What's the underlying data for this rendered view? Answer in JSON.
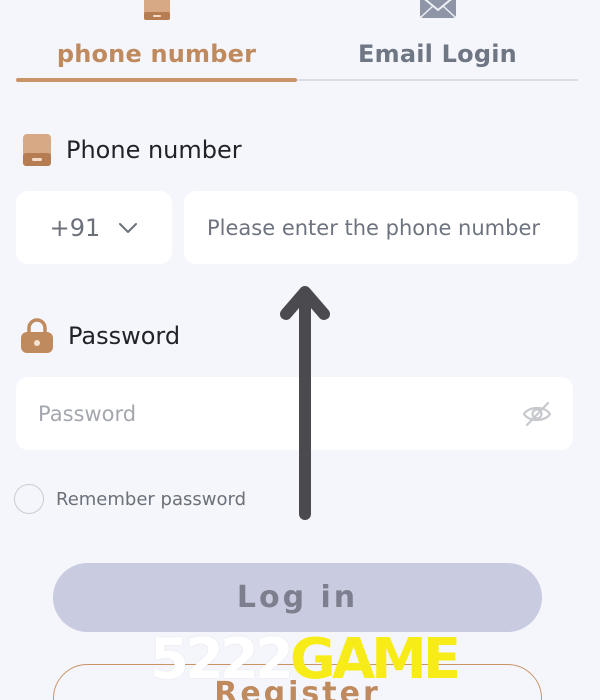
{
  "colors": {
    "accent": "#c99567",
    "accent_text": "#c08a5f",
    "inactive_tab": "#707784",
    "login_button_bg": "#c9cbe0",
    "login_button_text": "#7d7f8e",
    "page_bg": "#f5f6fb",
    "watermark_yellow": "#f7ec17"
  },
  "tabs": [
    {
      "label": "phone number",
      "icon": "phone-icon",
      "active": true
    },
    {
      "label": "Email Login",
      "icon": "envelope-icon",
      "active": false
    }
  ],
  "phone": {
    "label": "Phone number",
    "icon": "phone-icon",
    "country_code": "+91",
    "placeholder": "Please enter the phone number",
    "value": ""
  },
  "password": {
    "label": "Password",
    "icon": "lock-icon",
    "placeholder": "Password",
    "toggle_icon": "eye-off-icon"
  },
  "remember": {
    "label": "Remember password",
    "checked": false
  },
  "buttons": {
    "login": "Log in",
    "register": "Register"
  },
  "watermark": {
    "number": "5222",
    "word": "GAME"
  },
  "annotation": {
    "icon": "up-arrow-icon"
  }
}
